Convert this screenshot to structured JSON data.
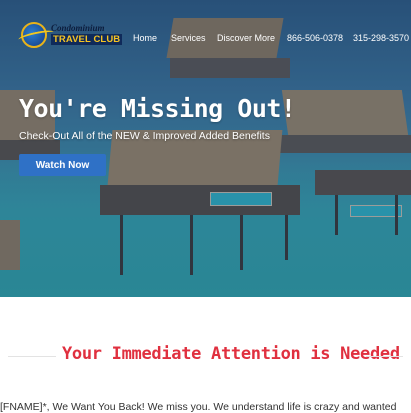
{
  "logo": {
    "line1": "Condominium",
    "line2": "TRAVEL CLUB"
  },
  "nav": {
    "items": [
      {
        "label": "Home"
      },
      {
        "label": "Services"
      },
      {
        "label": "Discover More"
      },
      {
        "label": "866-506-0378"
      },
      {
        "label": "315-298-3570"
      }
    ]
  },
  "hero": {
    "title": "You're Missing Out!",
    "subtitle": "Check-Out All of the NEW & Improved Added Benefits",
    "button_label": "Watch Now"
  },
  "section": {
    "heading": "Your Immediate Attention is Needed",
    "body": "[FNAME]*, We Want You Back! We miss you. We understand life is crazy and wanted"
  },
  "colors": {
    "accent_red": "#e0303f",
    "button_blue": "#2f71c6",
    "logo_gold": "#f6c423"
  }
}
